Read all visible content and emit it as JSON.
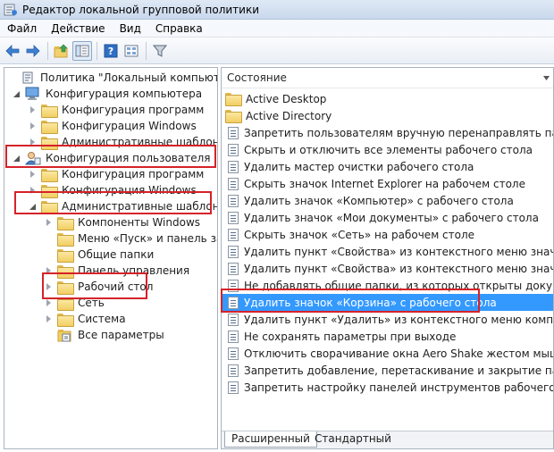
{
  "window": {
    "title": "Редактор локальной групповой политики"
  },
  "menu": [
    "Файл",
    "Действие",
    "Вид",
    "Справка"
  ],
  "toolbar": {
    "buttons": [
      "back-arrow-icon",
      "forward-arrow-icon",
      "up-folder-icon",
      "show-hide-tree-icon",
      "help-icon",
      "view-icon",
      "filter-icon"
    ]
  },
  "tree": {
    "items": [
      {
        "label": "Политика \"Локальный компьютер\"",
        "level": 0,
        "arrow": "none",
        "icon": "computer-policy"
      },
      {
        "label": "Конфигурация компьютера",
        "level": 1,
        "arrow": "open",
        "icon": "computer"
      },
      {
        "label": "Конфигурация программ",
        "level": 2,
        "arrow": "closed",
        "icon": "folder"
      },
      {
        "label": "Конфигурация Windows",
        "level": 2,
        "arrow": "closed",
        "icon": "folder"
      },
      {
        "label": "Административные шаблоны",
        "level": 2,
        "arrow": "closed",
        "icon": "folder"
      },
      {
        "label": "Конфигурация пользователя",
        "level": 1,
        "arrow": "open",
        "icon": "user"
      },
      {
        "label": "Конфигурация программ",
        "level": 2,
        "arrow": "closed",
        "icon": "folder"
      },
      {
        "label": "Конфигурация Windows",
        "level": 2,
        "arrow": "closed",
        "icon": "folder"
      },
      {
        "label": "Административные шаблоны",
        "level": 2,
        "arrow": "open",
        "icon": "folder"
      },
      {
        "label": "Компоненты Windows",
        "level": 3,
        "arrow": "closed",
        "icon": "folder"
      },
      {
        "label": "Меню «Пуск» и панель задач",
        "level": 3,
        "arrow": "none",
        "icon": "folder"
      },
      {
        "label": "Общие папки",
        "level": 3,
        "arrow": "none",
        "icon": "folder"
      },
      {
        "label": "Панель управления",
        "level": 3,
        "arrow": "closed",
        "icon": "folder"
      },
      {
        "label": "Рабочий стол",
        "level": 3,
        "arrow": "closed",
        "icon": "folder"
      },
      {
        "label": "Сеть",
        "level": 3,
        "arrow": "closed",
        "icon": "folder"
      },
      {
        "label": "Система",
        "level": 3,
        "arrow": "closed",
        "icon": "folder"
      },
      {
        "label": "Все параметры",
        "level": 3,
        "arrow": "none",
        "icon": "settings"
      }
    ]
  },
  "list": {
    "header": "Состояние",
    "items": [
      {
        "label": "Active Desktop",
        "icon": "folder"
      },
      {
        "label": "Active Directory",
        "icon": "folder"
      },
      {
        "label": "Запретить пользователям вручную перенаправлять папк...",
        "icon": "policy"
      },
      {
        "label": "Скрыть и отключить все элементы рабочего стола",
        "icon": "policy"
      },
      {
        "label": "Удалить мастер очистки рабочего стола",
        "icon": "policy"
      },
      {
        "label": "Скрыть значок Internet Explorer на рабочем столе",
        "icon": "policy"
      },
      {
        "label": "Удалить значок «Компьютер» с рабочего стола",
        "icon": "policy"
      },
      {
        "label": "Удалить значок «Мои документы» с рабочего стола",
        "icon": "policy"
      },
      {
        "label": "Скрыть значок «Сеть» на рабочем столе",
        "icon": "policy"
      },
      {
        "label": "Удалить пункт «Свойства» из контекстного меню значка ...",
        "icon": "policy"
      },
      {
        "label": "Удалить пункт «Свойства» из контекстного меню значка ...",
        "icon": "policy"
      },
      {
        "label": "Не добавлять общие папки, из которых открыты докуме...",
        "icon": "policy"
      },
      {
        "label": "Удалить значок «Корзина» с рабочего стола",
        "icon": "policy",
        "selected": true
      },
      {
        "label": "Удалить пункт «Удалить» из контекстного меню компон...",
        "icon": "policy"
      },
      {
        "label": "Не сохранять параметры при выходе",
        "icon": "policy"
      },
      {
        "label": "Отключить сворачивание окна Aero Shake жестом мышь...",
        "icon": "policy"
      },
      {
        "label": "Запретить добавление, перетаскивание и закрытие пане...",
        "icon": "policy"
      },
      {
        "label": "Запретить настройку панелей инструментов рабочего ст...",
        "icon": "policy"
      }
    ]
  },
  "tabs": [
    "Расширенный",
    "Стандартный"
  ],
  "colors": {
    "selection": "#3399ff",
    "highlight_box": "#d62228"
  }
}
